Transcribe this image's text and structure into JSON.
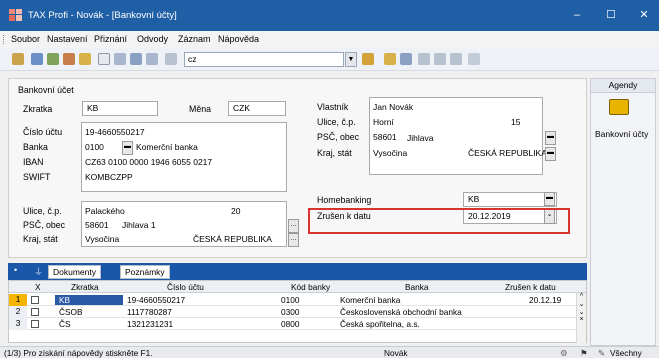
{
  "window": {
    "title": "TAX Profi - Novák - [Bankovní účty]",
    "minimize_glyph": "–",
    "maximize_glyph": "☐",
    "close_glyph": "✕"
  },
  "menu": [
    "Soubor",
    "Nastavení",
    "Přiznání",
    "Odvody",
    "Záznam",
    "Nápověda"
  ],
  "toolbar": {
    "combo_value": "cz"
  },
  "form": {
    "section_title": "Bankovní účet",
    "zkratka": {
      "label": "Zkratka",
      "value": "KB"
    },
    "mena": {
      "label": "Měna",
      "value": "CZK"
    },
    "cislo_uctu": {
      "label": "Číslo účtu",
      "value": "19-4660550217"
    },
    "banka": {
      "label": "Banka",
      "code": "0100",
      "name": "Komerční banka"
    },
    "iban": {
      "label": "IBAN",
      "value": "CZ63 0100 0000 1946 6055 0217"
    },
    "swift": {
      "label": "SWIFT",
      "value": "KOMBCZPP"
    },
    "vlastnik": {
      "label": "Vlastník",
      "value": "Jan Novák"
    },
    "ulice_cp_owner": {
      "label": "Ulice, č.p.",
      "street": "Horní",
      "number": "15"
    },
    "psc_obec_owner": {
      "label": "PSČ, obec",
      "psc": "58601",
      "obec": "Jihlava"
    },
    "kraj_stat_owner": {
      "label": "Kraj, stát",
      "kraj": "Vysočina",
      "stat": "ČESKÁ REPUBLIKA"
    },
    "ulice_cp_bank": {
      "label": "Ulice, č.p.",
      "street": "Palackého",
      "number": "20"
    },
    "psc_obec_bank": {
      "label": "PSČ, obec",
      "psc": "58601",
      "obec": "Jihlava 1"
    },
    "kraj_stat_bank": {
      "label": "Kraj, stát",
      "kraj": "Vysočina",
      "stat": "ČESKÁ REPUBLIKA"
    },
    "homebanking": {
      "label": "Homebanking",
      "value": "KB"
    },
    "zrusen": {
      "label": "Zrušen k datu",
      "value": "20.12.2019"
    }
  },
  "agendy": {
    "title": "Agendy",
    "item_label": "Bankovní účty"
  },
  "tabs": {
    "dokumenty": "Dokumenty",
    "poznamky": "Poznámky"
  },
  "grid": {
    "columns": [
      "X",
      "Zkratka",
      "Číslo účtu",
      "Kód banky",
      "Banka",
      "Zrušen k datu"
    ],
    "rows": [
      {
        "n": "1",
        "zkratka": "KB",
        "cislo": "19-4660550217",
        "kod": "0100",
        "banka": "Komerční banka",
        "zrusen": "20.12.19"
      },
      {
        "n": "2",
        "zkratka": "ČSOB",
        "cislo": "1117780287",
        "kod": "0300",
        "banka": "Československá obchodní banka",
        "zrusen": ""
      },
      {
        "n": "3",
        "zkratka": "ČS",
        "cislo": "1321231231",
        "kod": "0800",
        "banka": "Česká spořitelna, a.s.",
        "zrusen": ""
      }
    ]
  },
  "status": {
    "left": "(1/3) Pro získání nápovědy stiskněte F1.",
    "center": "Novák",
    "right": "Všechny"
  },
  "colors": {
    "titlebar": "#1f5fa6",
    "selection": "#2a5aa5",
    "highlight_border": "#d9322f"
  }
}
